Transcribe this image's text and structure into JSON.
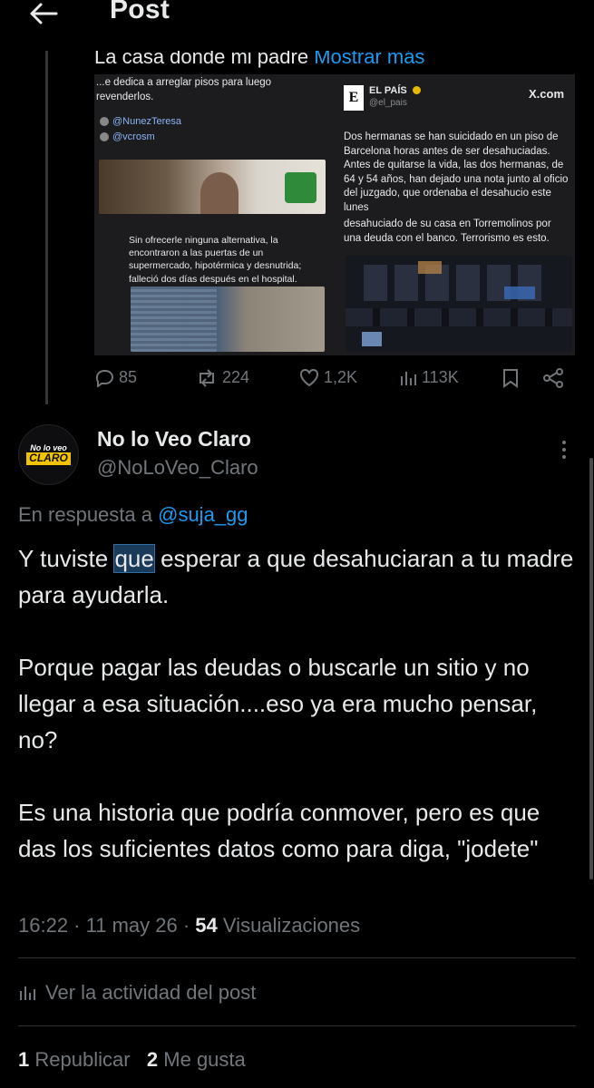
{
  "header": {
    "title": "Post"
  },
  "quoted": {
    "text": "La casa donde mi padre",
    "more": "Mostrar más",
    "embed": {
      "left_top": "...e dedica a arreglar pisos para luego revenderlos.",
      "handle1": "@NunezTeresa",
      "handle2": "@vcrosm",
      "left_caption": "Sin ofrecerle ninguna alternativa, la encontraron a las puertas de un supermercado, hipotérmica y desnutrida; falleció dos días después en el hospital.",
      "source_name": "EL PAÍS",
      "source_handle": "@el_pais",
      "source_site": "X.com",
      "right_text": "Dos hermanas se han suicidado en un piso de Barcelona horas antes de ser desahuciadas. Antes de quitarse la vida, las dos hermanas, de 64 y 54 años, han dejado una nota junto al oficio del juzgado, que ordenaba el desahucio este lunes",
      "right_text2": "desahuciado de su casa en Torremolinos por una deuda con el banco. Terrorismo es esto."
    },
    "actions": {
      "replies": "85",
      "reposts": "224",
      "likes": "1,2K",
      "views": "113K"
    }
  },
  "reply": {
    "avatar_line1": "No lo veo",
    "avatar_line2": "CLARO",
    "name": "No lo Veo Claro",
    "handle": "@NoLoVeo_Claro",
    "reply_prefix": "En respuesta a",
    "reply_handle": "@suja_gg",
    "body": {
      "p1_before": "Y tuviste ",
      "p1_highlight": "que",
      "p1_after": " esperar a que desahuciaran a tu madre para ayudarla.",
      "p2": "Porque pagar las deudas o buscarle un sitio y no llegar a esa situación....eso ya era mucho pensar, no?",
      "p3": "Es una historia que podría conmover, pero es que das los suficientes datos como para diga, \"jodete\""
    },
    "time": "16:22",
    "date": "11 may 26",
    "views_count": "54",
    "views_label": "Visualizaciones",
    "activity_label": "Ver la actividad del post",
    "reposts_count": "1",
    "reposts_label": "Republicar",
    "likes_count": "2",
    "likes_label": "Me gusta"
  }
}
